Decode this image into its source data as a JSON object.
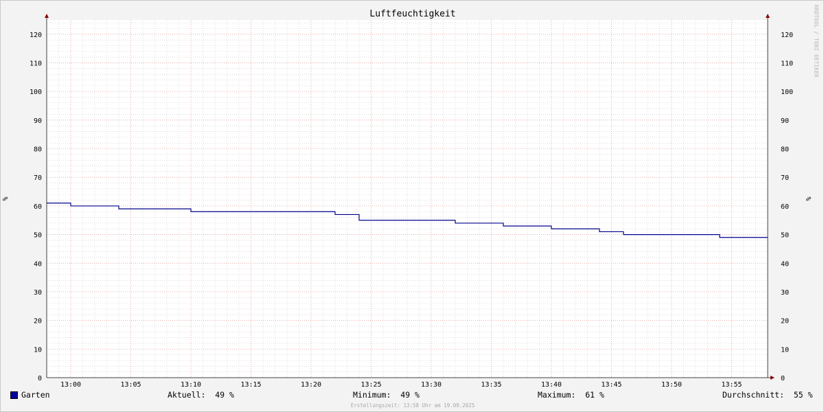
{
  "chart_data": {
    "type": "line",
    "title": "Luftfeuchtigkeit",
    "ylabel": "%",
    "ylabel_right": "%",
    "ylim": [
      0,
      125
    ],
    "yticks": [
      0,
      10,
      20,
      30,
      40,
      50,
      60,
      70,
      80,
      90,
      100,
      110,
      120
    ],
    "xlim": [
      "12:58",
      "13:58"
    ],
    "xticks": [
      "13:00",
      "13:05",
      "13:10",
      "13:15",
      "13:20",
      "13:25",
      "13:30",
      "13:35",
      "13:40",
      "13:45",
      "13:50",
      "13:55"
    ],
    "grid": true,
    "series": [
      {
        "name": "Garten",
        "color": "#00008b",
        "step": true,
        "points": [
          {
            "x": "12:58",
            "y": 61
          },
          {
            "x": "13:00",
            "y": 60
          },
          {
            "x": "13:04",
            "y": 59
          },
          {
            "x": "13:10",
            "y": 58
          },
          {
            "x": "13:22",
            "y": 57
          },
          {
            "x": "13:24",
            "y": 55
          },
          {
            "x": "13:32",
            "y": 54
          },
          {
            "x": "13:36",
            "y": 53
          },
          {
            "x": "13:40",
            "y": 52
          },
          {
            "x": "13:44",
            "y": 51
          },
          {
            "x": "13:46",
            "y": 50
          },
          {
            "x": "13:54",
            "y": 49
          },
          {
            "x": "13:58",
            "y": 49
          }
        ]
      }
    ]
  },
  "legend": {
    "series_name": "Garten",
    "swatch_color": "#0000a0",
    "current": "Aktuell:  49 %",
    "minimum": "Minimum:  49 %",
    "maximum": "Maximum:  61 %",
    "average": "Durchschnitt:  55 %"
  },
  "footer": "Erstellungszeit: 13:58 Uhr am 19.09.2025",
  "watermark": "RRDTOOL / TOBI OETIKER"
}
